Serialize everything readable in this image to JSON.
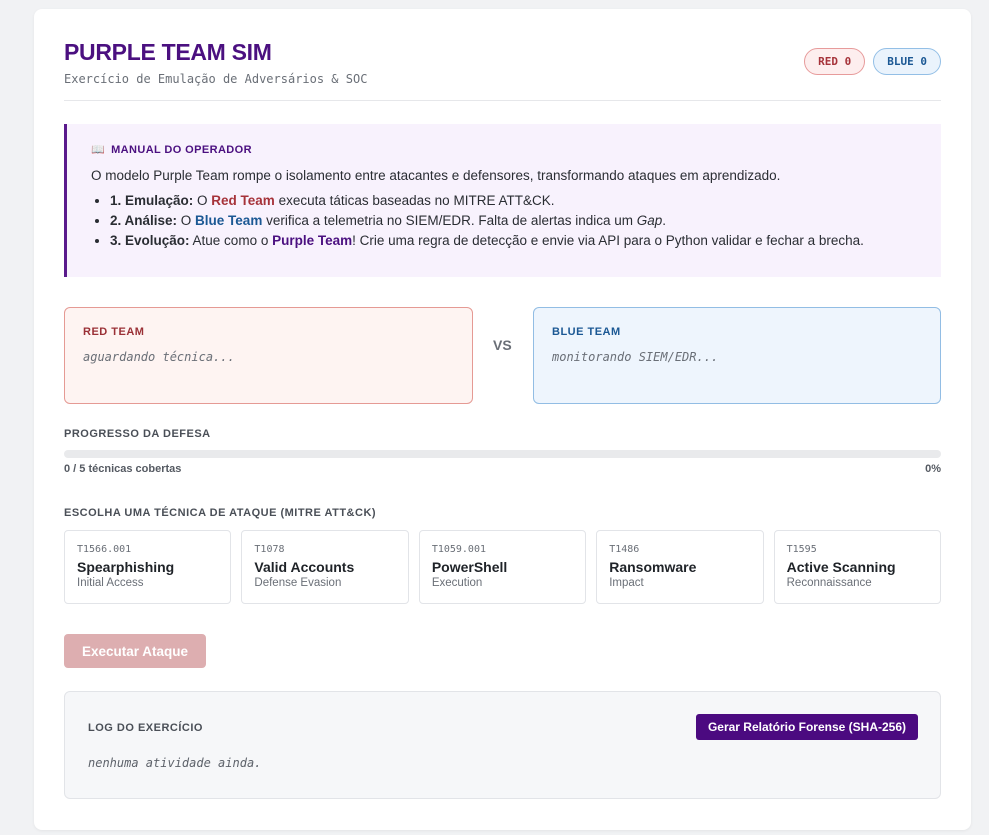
{
  "header": {
    "title": "PURPLE TEAM SIM",
    "subtitle": "Exercício de Emulação de Adversários & SOC",
    "red_badge": "RED 0",
    "blue_badge": "BLUE 0"
  },
  "manual": {
    "icon": "book-icon",
    "title": "MANUAL DO OPERADOR",
    "intro": "O modelo Purple Team rompe o isolamento entre atacantes e defensores, transformando ataques em aprendizado.",
    "item1": {
      "lead": "1. Emulação:",
      "pre": " O ",
      "team": "Red Team",
      "post": " executa táticas baseadas no MITRE ATT&CK."
    },
    "item2": {
      "lead": "2. Análise:",
      "pre": " O ",
      "team": "Blue Team",
      "post": " verifica a telemetria no SIEM/EDR. Falta de alertas indica um ",
      "em": "Gap",
      "end": "."
    },
    "item3": {
      "lead": "3. Evolução:",
      "pre": " Atue como o ",
      "team": "Purple Team",
      "post": "! Crie uma regra de detecção e envie via API para o Python validar e fechar a brecha."
    }
  },
  "red_team": {
    "label": "RED TEAM",
    "status": "aguardando técnica..."
  },
  "vs": "VS",
  "blue_team": {
    "label": "BLUE TEAM",
    "status": "monitorando SIEM/EDR..."
  },
  "progress": {
    "label": "PROGRESSO DA DEFESA",
    "covered_text": "0 / 5 técnicas cobertas",
    "percent_text": "0%",
    "value": 0
  },
  "techniques": {
    "label": "ESCOLHA UMA TÉCNICA DE ATAQUE (MITRE ATT&CK)",
    "items": [
      {
        "id": "T1566.001",
        "name": "Spearphishing",
        "tactic": "Initial Access"
      },
      {
        "id": "T1078",
        "name": "Valid Accounts",
        "tactic": "Defense Evasion"
      },
      {
        "id": "T1059.001",
        "name": "PowerShell",
        "tactic": "Execution"
      },
      {
        "id": "T1486",
        "name": "Ransomware",
        "tactic": "Impact"
      },
      {
        "id": "T1595",
        "name": "Active Scanning",
        "tactic": "Reconnaissance"
      }
    ]
  },
  "execute_button": "Executar Ataque",
  "log": {
    "title": "LOG DO EXERCÍCIO",
    "report_button": "Gerar Relatório Forense (SHA-256)",
    "empty": "nenhuma atividade ainda."
  },
  "colors": {
    "purple": "#4b1080",
    "red": "#a6333a",
    "blue": "#1b5894"
  }
}
